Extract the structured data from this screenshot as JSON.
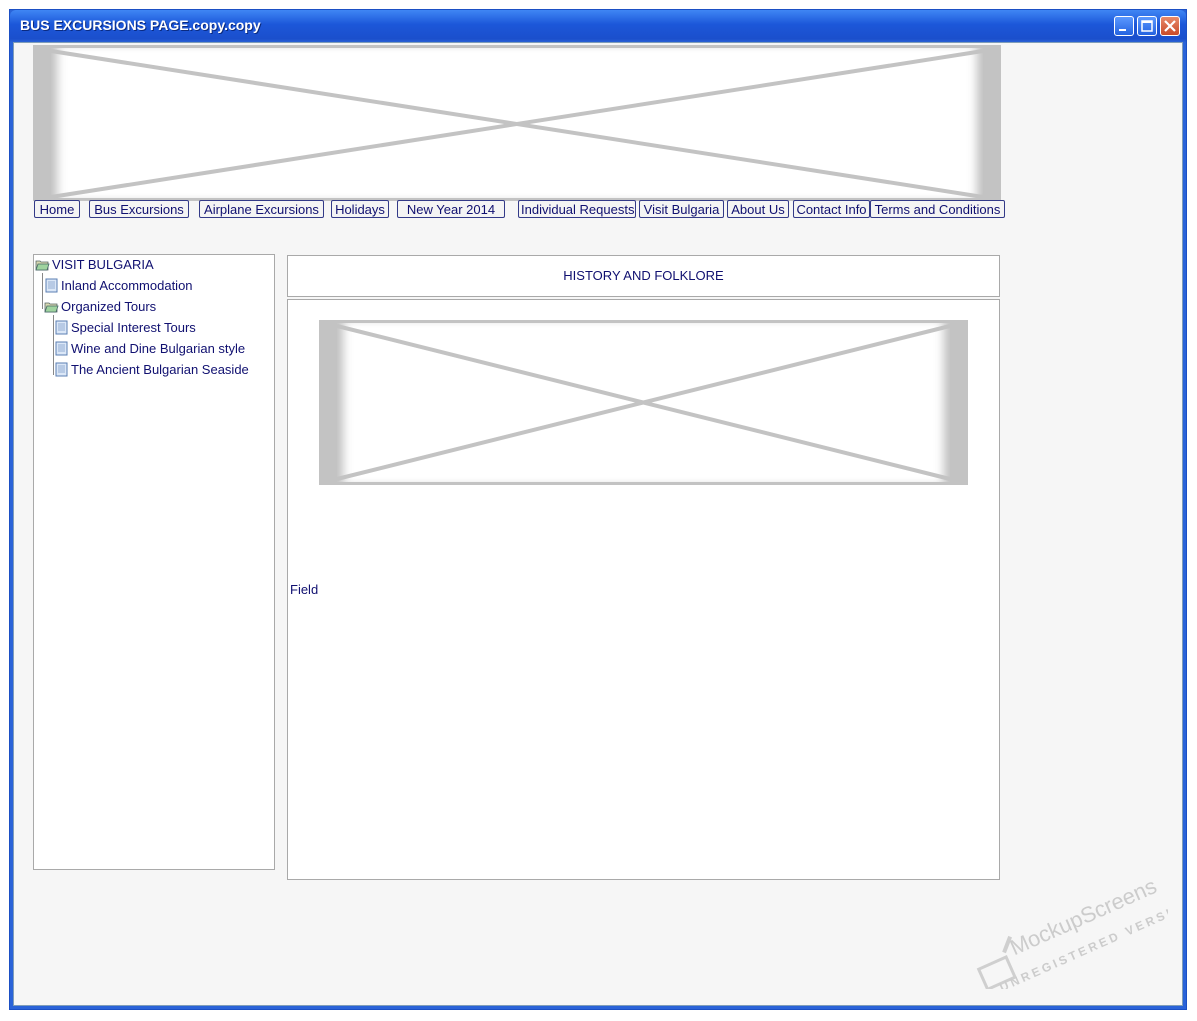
{
  "window": {
    "title": "BUS EXCURSIONS PAGE.copy.copy"
  },
  "nav": {
    "items": [
      {
        "label": "Home"
      },
      {
        "label": "Bus Excursions"
      },
      {
        "label": "Airplane Excursions"
      },
      {
        "label": "Holidays"
      },
      {
        "label": "New Year 2014"
      },
      {
        "label": "Individual Requests"
      },
      {
        "label": "Visit Bulgaria"
      },
      {
        "label": "About Us"
      },
      {
        "label": "Contact Info"
      },
      {
        "label": "Terms and Conditions"
      }
    ]
  },
  "tree": {
    "root": "VISIT BULGARIA",
    "items": [
      {
        "label": "Inland Accommodation",
        "icon": "document-icon"
      },
      {
        "label": "Organized Tours",
        "icon": "open-folder-icon"
      },
      {
        "label": "Special Interest Tours",
        "icon": "document-icon"
      },
      {
        "label": "Wine and Dine Bulgarian style",
        "icon": "document-icon"
      },
      {
        "label": "The Ancient Bulgarian Seaside",
        "icon": "document-icon"
      }
    ]
  },
  "content": {
    "heading": "HISTORY AND FOLKLORE",
    "field_label": "Field"
  },
  "watermark": {
    "brand": "MockupScreens",
    "note": "UNREGISTERED VERSION"
  },
  "colors": {
    "title_bar": "#1c57d9",
    "text": "#101070",
    "placeholder_gray": "#c3c3c3",
    "background": "#f6f6f6"
  }
}
